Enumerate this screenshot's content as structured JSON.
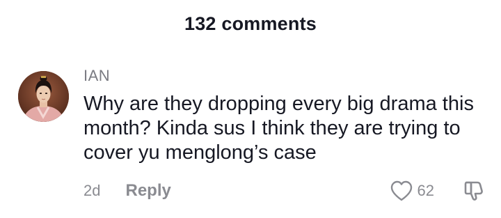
{
  "header": {
    "title": "132 comments"
  },
  "comment": {
    "username": "IAN",
    "avatar_icon": "avatar-portrait",
    "text": "Why are they dropping every big drama this month? Kinda sus I think they are trying to cover yu menglong’s case",
    "timestamp": "2d",
    "reply_label": "Reply",
    "like_count": "62",
    "like_icon": "heart-outline-icon",
    "dislike_icon": "thumbs-down-icon"
  },
  "colors": {
    "text_primary": "#161823",
    "text_secondary": "#8a8b91",
    "username": "#7a7b82",
    "background": "#ffffff"
  }
}
